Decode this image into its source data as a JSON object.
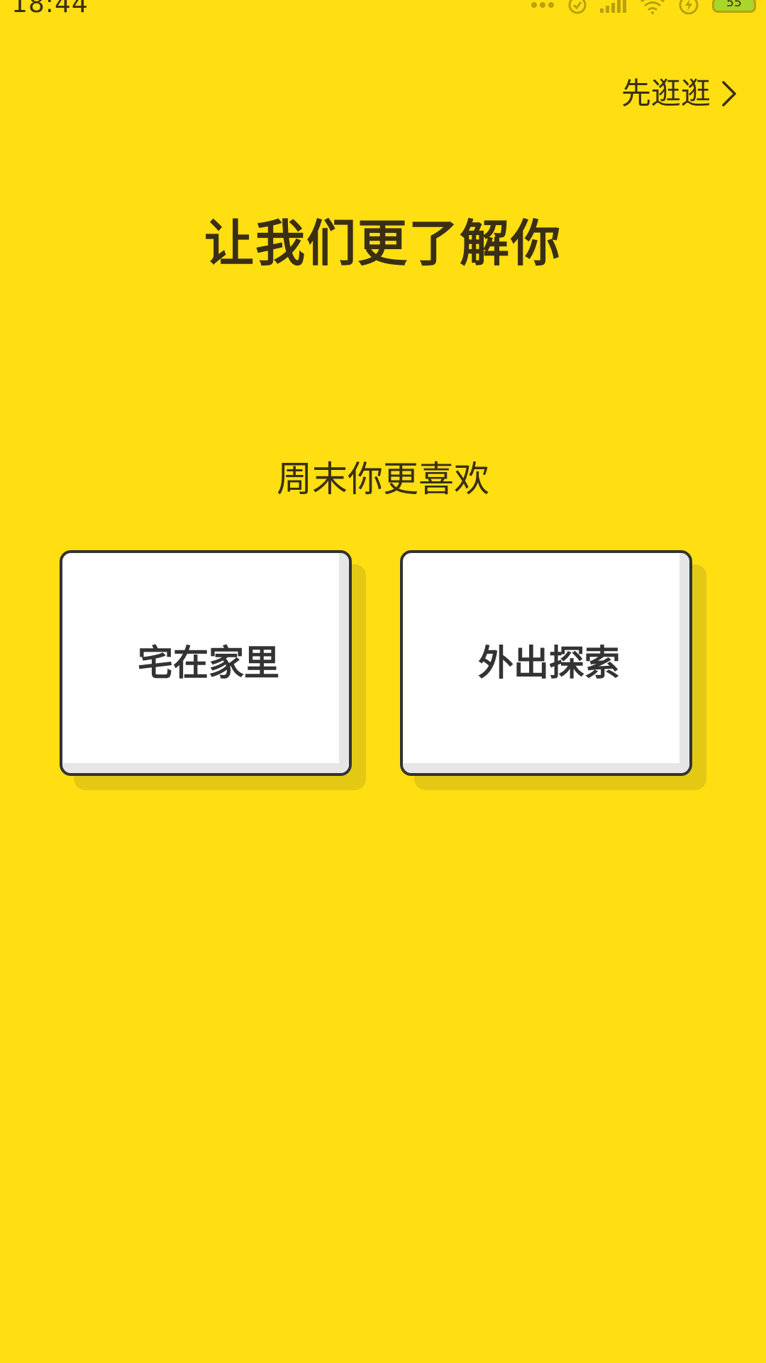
{
  "status_bar": {
    "time": "18:44",
    "battery_level": "55",
    "icons": [
      "more-dots-icon",
      "alarm-icon",
      "signal-icon",
      "wifi-icon",
      "charging-icon",
      "battery-icon"
    ]
  },
  "header": {
    "skip_label": "先逛逛",
    "skip_icon": "chevron-right-icon"
  },
  "main": {
    "title": "让我们更了解你",
    "question": "周末你更喜欢",
    "options": [
      {
        "label": "宅在家里"
      },
      {
        "label": "外出探索"
      }
    ]
  },
  "colors": {
    "background": "#FFDF12",
    "text": "#3A2F14",
    "card": "#FFFFFF",
    "card_border": "#333333",
    "card_shadow": "#E3C814"
  }
}
